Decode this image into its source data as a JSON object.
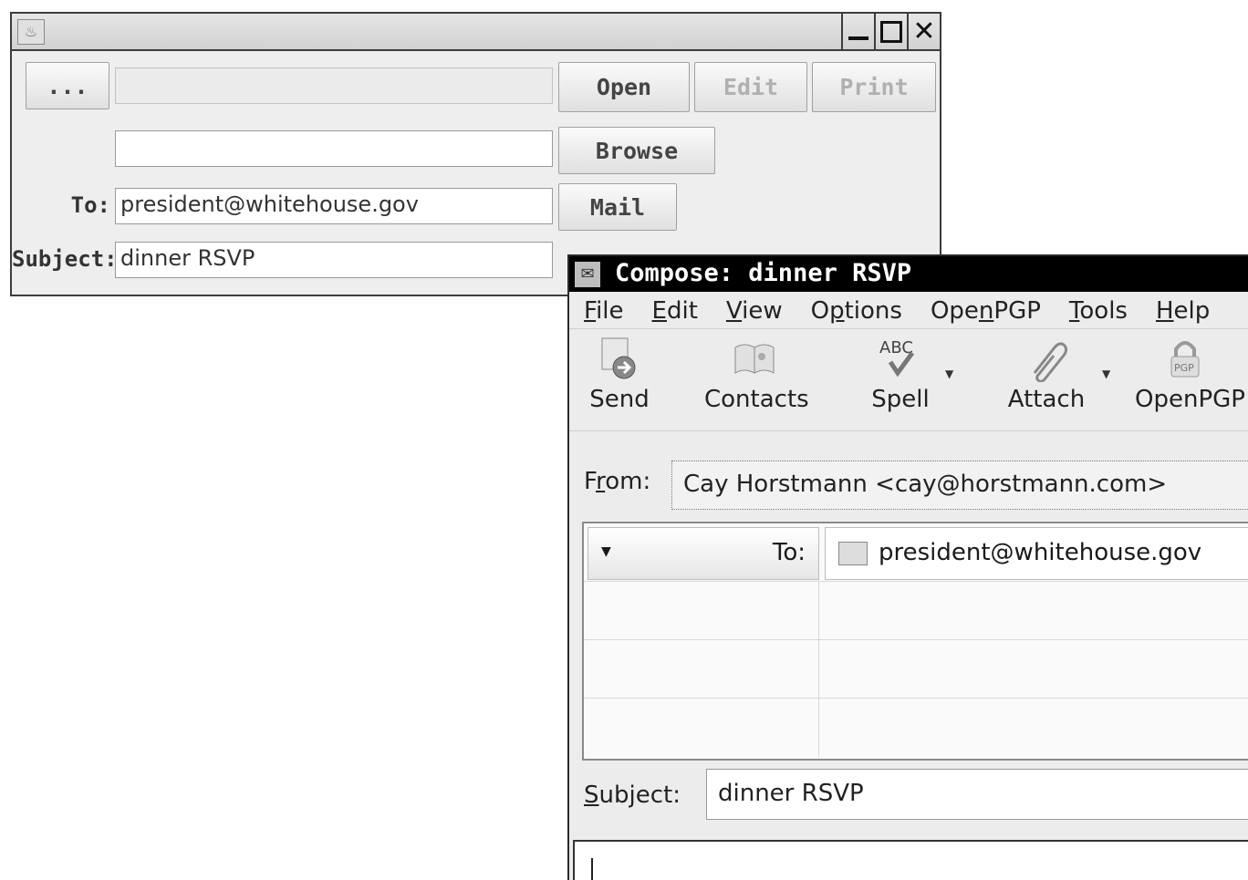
{
  "java_window": {
    "icon": "java-cup-icon",
    "controls": {
      "minimize": "minimize-icon",
      "maximize": "maximize-icon",
      "close": "close-icon",
      "close_glyph": "✕"
    },
    "choose_button": "...",
    "file_path_value": "",
    "open_button": "Open",
    "edit_button": "Edit",
    "print_button": "Print",
    "browse_value": "",
    "browse_button": "Browse",
    "to_label": "To:",
    "to_value": "president@whitehouse.gov",
    "mail_button": "Mail",
    "subject_label": "Subject:",
    "subject_value": "dinner RSVP"
  },
  "compose_window": {
    "title": "Compose: dinner RSVP",
    "menu": [
      {
        "pre": "",
        "key": "F",
        "post": "ile"
      },
      {
        "pre": "",
        "key": "E",
        "post": "dit"
      },
      {
        "pre": "",
        "key": "V",
        "post": "iew"
      },
      {
        "pre": "O",
        "key": "p",
        "post": "tions"
      },
      {
        "pre": "Ope",
        "key": "n",
        "post": "PGP"
      },
      {
        "pre": "",
        "key": "T",
        "post": "ools"
      },
      {
        "pre": "",
        "key": "H",
        "post": "elp"
      }
    ],
    "toolbar": [
      {
        "label": "Send",
        "icon": "send-icon"
      },
      {
        "label": "Contacts",
        "icon": "address-book-icon"
      },
      {
        "label": "Spell",
        "icon": "spellcheck-icon"
      },
      {
        "label": "Attach",
        "icon": "paperclip-icon"
      },
      {
        "label": "OpenPGP",
        "icon": "lock-icon"
      }
    ],
    "from_label_pre": "F",
    "from_label_key": "r",
    "from_label_post": "om:",
    "from_value": "Cay Horstmann <cay@horstmann.com>",
    "recipient_type": "To:",
    "recipient_value": "president@whitehouse.gov",
    "subject_label_key": "S",
    "subject_label_post": "ubject:",
    "subject_value": "dinner RSVP",
    "body_text": ""
  }
}
